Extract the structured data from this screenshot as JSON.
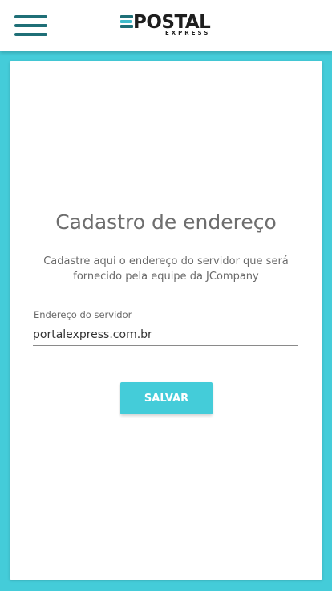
{
  "header": {
    "menu_icon": "hamburger-menu-icon",
    "logo": {
      "name": "POSTAL",
      "tagline": "EXPRESS",
      "colors": {
        "dark": "#1f6f77",
        "light": "#3fbccb",
        "text": "#1e1e1e"
      }
    }
  },
  "form": {
    "title": "Cadastro de endereço",
    "description": "Cadastre aqui o endereço do servidor que será fornecido pela equipe da JCompany",
    "server_field": {
      "label": "Endereço do servidor",
      "value": "portalexpress.com.br"
    },
    "save_label": "SALVAR"
  },
  "colors": {
    "accent": "#44ccd9",
    "header_bg": "#ffffff",
    "card_bg": "#ffffff"
  }
}
